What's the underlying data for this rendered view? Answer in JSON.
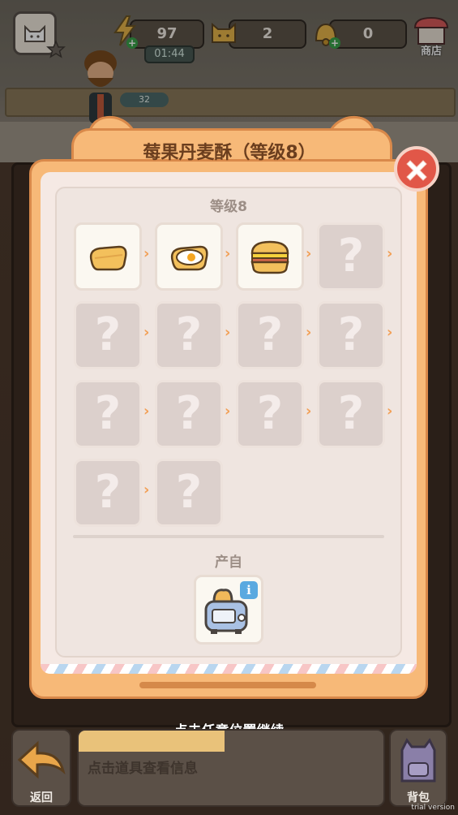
{
  "hud": {
    "energy_value": "97",
    "energy_timer": "01:44",
    "cat_value": "2",
    "bell_value": "0",
    "shop_label": "商店",
    "player_level": "32"
  },
  "popup": {
    "title": "莓果丹麦酥（等级8）",
    "level_label": "等级8",
    "chain": [
      {
        "state": "known",
        "icon": "toast-icon"
      },
      {
        "state": "known",
        "icon": "egg-toast-icon"
      },
      {
        "state": "known",
        "icon": "sandwich-icon"
      },
      {
        "state": "unknown",
        "icon": "question-icon"
      },
      {
        "state": "unknown",
        "icon": "question-icon"
      },
      {
        "state": "unknown",
        "icon": "question-icon"
      },
      {
        "state": "unknown",
        "icon": "question-icon"
      },
      {
        "state": "unknown",
        "icon": "question-icon"
      },
      {
        "state": "unknown",
        "icon": "question-icon"
      },
      {
        "state": "unknown",
        "icon": "question-icon"
      },
      {
        "state": "unknown",
        "icon": "question-icon"
      },
      {
        "state": "unknown",
        "icon": "question-icon"
      },
      {
        "state": "unknown",
        "icon": "question-icon"
      },
      {
        "state": "unknown",
        "icon": "question-icon"
      }
    ],
    "unknown_glyph": "?",
    "source_label": "产自",
    "source_icon": "toaster-icon",
    "info_glyph": "i"
  },
  "continue_hint": "点击任意位置继续",
  "bottom": {
    "back_label": "返回",
    "info_placeholder": "点击道具查看信息",
    "bag_label": "背包"
  },
  "watermark": "trial version",
  "colors": {
    "popup_orange": "#f7b978",
    "title_brown": "#6b3e1e",
    "arrow_orange": "#f2a057",
    "close_red": "#e15748",
    "info_blue": "#5aa9e0"
  }
}
